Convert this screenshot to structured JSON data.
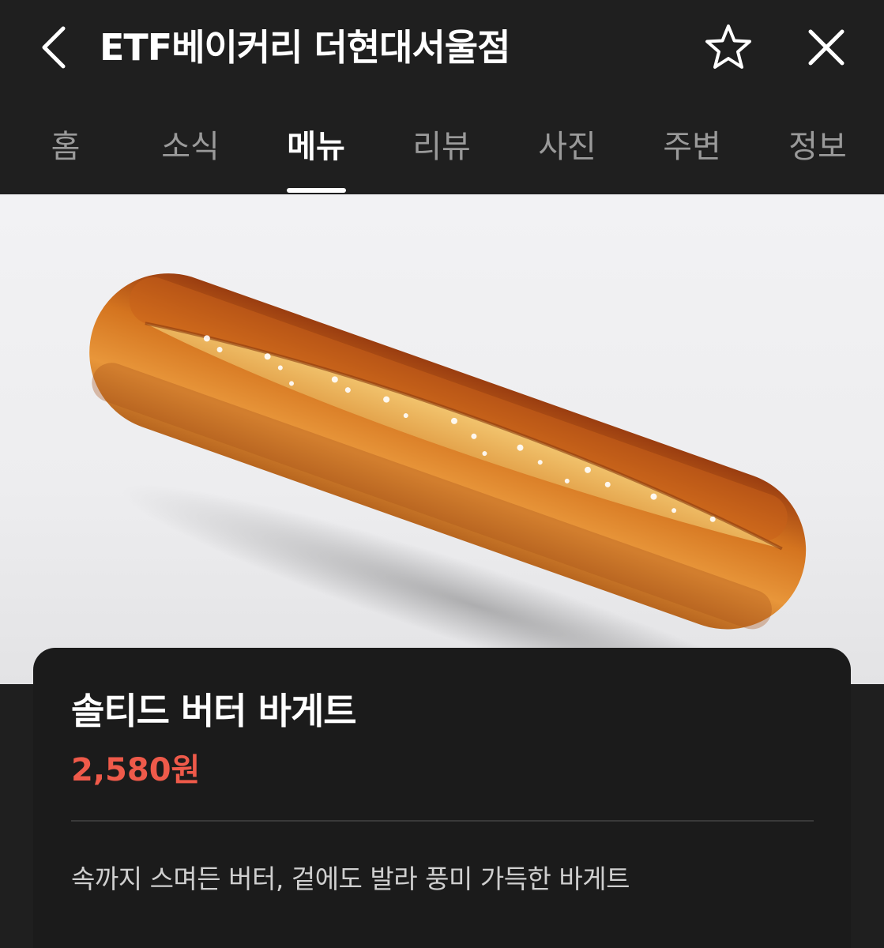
{
  "header": {
    "back_icon": "chevron-left-icon",
    "title": "ETF베이커리 더현대서울점",
    "favorite_icon": "star-outline-icon",
    "close_icon": "close-icon"
  },
  "tabs": [
    {
      "label": "홈",
      "active": false
    },
    {
      "label": "소식",
      "active": false
    },
    {
      "label": "메뉴",
      "active": true
    },
    {
      "label": "리뷰",
      "active": false
    },
    {
      "label": "사진",
      "active": false
    },
    {
      "label": "주변",
      "active": false
    },
    {
      "label": "정보",
      "active": false
    }
  ],
  "menu_item": {
    "image": "baguette-photo",
    "name": "솔티드 버터 바게트",
    "price": "2,580원",
    "description": "속까지 스며든 버터, 겉에도 발라 풍미 가득한 바게트"
  },
  "colors": {
    "background": "#1f1f1f",
    "card": "#1b1b1b",
    "price": "#ef5a4a",
    "active_tab": "#ffffff",
    "inactive_tab": "#9a9a9a"
  }
}
